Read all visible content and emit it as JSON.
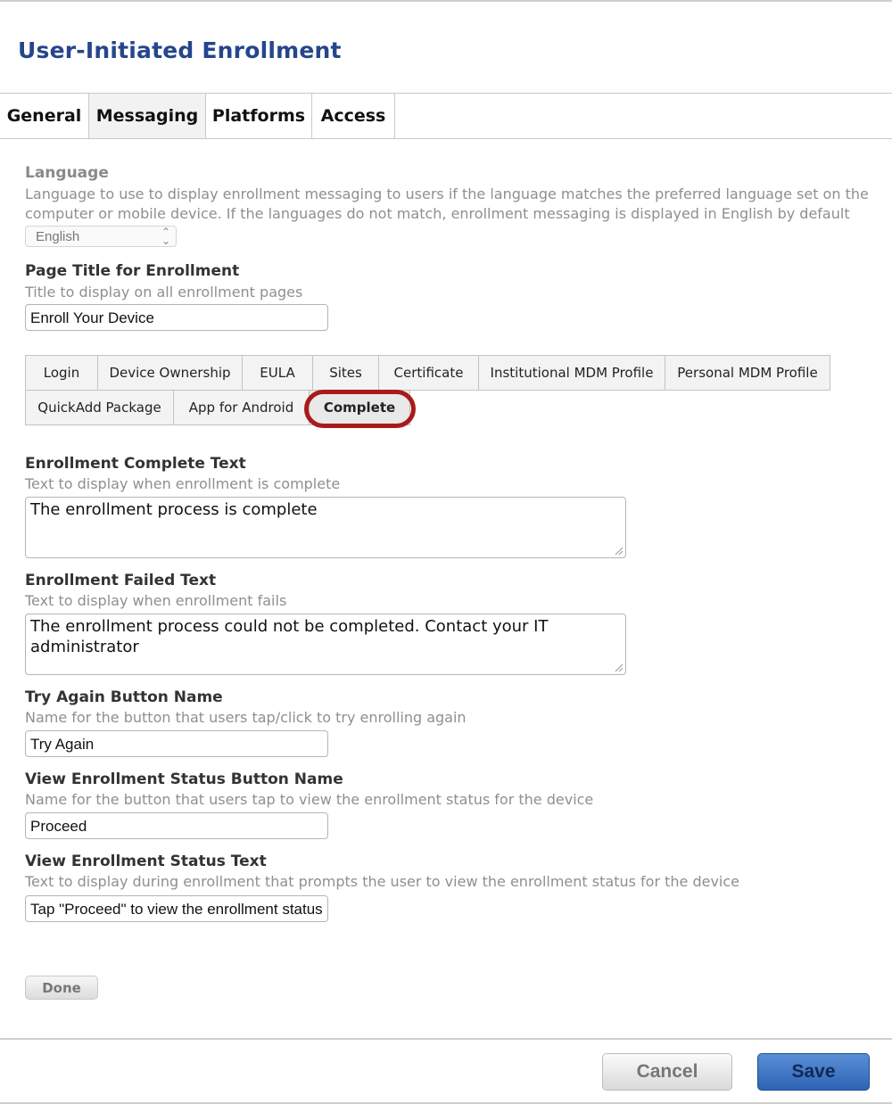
{
  "header": {
    "title": "User-Initiated Enrollment"
  },
  "main_tabs": [
    {
      "label": "General"
    },
    {
      "label": "Messaging"
    },
    {
      "label": "Platforms"
    },
    {
      "label": "Access"
    }
  ],
  "language": {
    "label": "Language",
    "description": "Language to use to display enrollment messaging to users if the language matches the preferred language set on the computer or mobile device. If the languages do not match, enrollment messaging is displayed in English by default",
    "selected": "English"
  },
  "page_title_field": {
    "label": "Page Title for Enrollment",
    "description": "Title to display on all enrollment pages",
    "value": "Enroll Your Device"
  },
  "sub_tabs": [
    {
      "label": "Login"
    },
    {
      "label": "Device Ownership"
    },
    {
      "label": "EULA"
    },
    {
      "label": "Sites"
    },
    {
      "label": "Certificate"
    },
    {
      "label": "Institutional MDM Profile"
    },
    {
      "label": "Personal MDM Profile"
    },
    {
      "label": "QuickAdd Package"
    },
    {
      "label": "App for Android"
    },
    {
      "label": "Complete"
    }
  ],
  "complete_text": {
    "label": "Enrollment Complete Text",
    "description": "Text to display when enrollment is complete",
    "value": "The enrollment process is complete"
  },
  "failed_text": {
    "label": "Enrollment Failed Text",
    "description": "Text to display when enrollment fails",
    "value": "The enrollment process could not be completed. Contact your IT administrator"
  },
  "try_again": {
    "label": "Try Again Button Name",
    "description": "Name for the button that users tap/click to try enrolling again",
    "value": "Try Again"
  },
  "view_status_button": {
    "label": "View Enrollment Status Button Name",
    "description": "Name for the button that users tap to view the enrollment status for the device",
    "value": "Proceed"
  },
  "view_status_text": {
    "label": "View Enrollment Status Text",
    "description": "Text to display during enrollment that prompts the user to view the enrollment status for the device",
    "value": "Tap \"Proceed\" to view the enrollment status"
  },
  "buttons": {
    "done": "Done",
    "cancel": "Cancel",
    "save": "Save"
  },
  "colors": {
    "title": "#24468c",
    "highlight": "#a91b1b",
    "save": "#2d63b4"
  },
  "icons": {
    "select_chevron": "chevron-updown-icon",
    "resize": "resize-grip-icon"
  }
}
